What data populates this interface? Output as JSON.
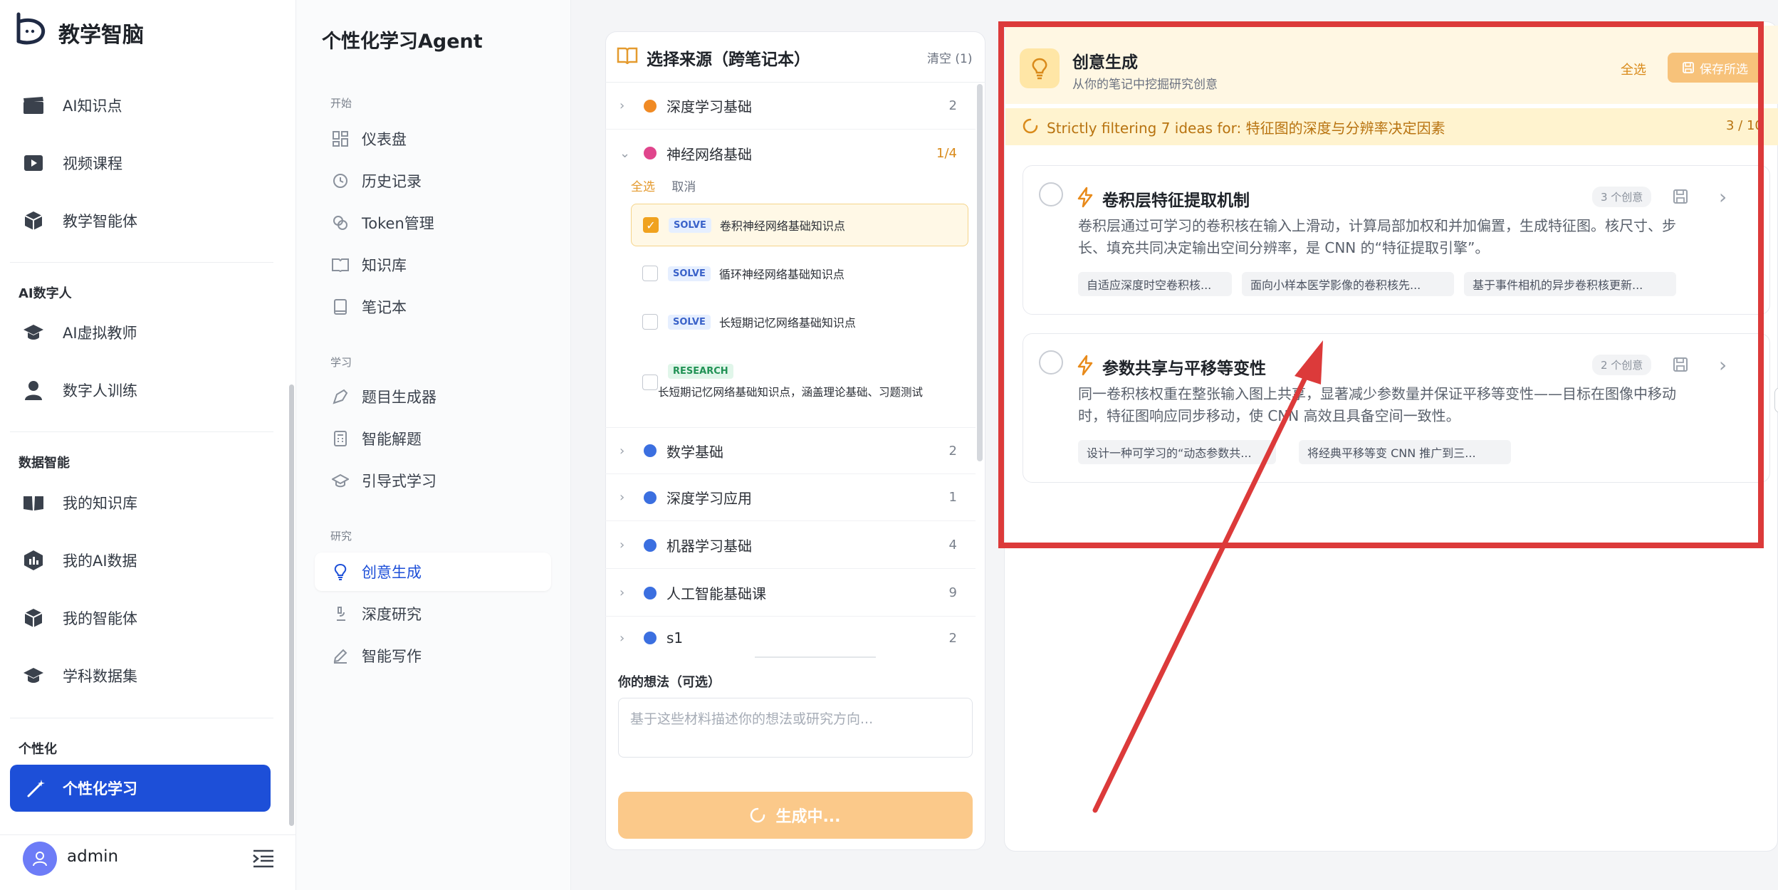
{
  "app": {
    "brand": "教学智脑"
  },
  "sidebar": {
    "items_top": [
      {
        "label": "AI知识点",
        "icon": "clapperboard-icon"
      },
      {
        "label": "视频课程",
        "icon": "video-play-icon"
      },
      {
        "label": "教学智能体",
        "icon": "cube-icon"
      }
    ],
    "section_digital": "AI数字人",
    "items_digital": [
      {
        "label": "AI虚拟教师",
        "icon": "graduation-cap-icon"
      },
      {
        "label": "数字人训练",
        "icon": "person-icon"
      }
    ],
    "section_data": "数据智能",
    "items_data": [
      {
        "label": "我的知识库",
        "icon": "open-book-icon"
      },
      {
        "label": "我的AI数据",
        "icon": "data-cube-icon"
      },
      {
        "label": "我的智能体",
        "icon": "cube-icon"
      },
      {
        "label": "学科数据集",
        "icon": "graduation-cap-icon"
      }
    ],
    "section_personal": "个性化",
    "active_item": "个性化学习",
    "user": "admin"
  },
  "subnav": {
    "title": "个性化学习Agent",
    "sec_start": "开始",
    "start_items": [
      "仪表盘",
      "历史记录",
      "Token管理",
      "知识库",
      "笔记本"
    ],
    "sec_learn": "学习",
    "learn_items": [
      "题目生成器",
      "智能解题",
      "引导式学习"
    ],
    "sec_research": "研究",
    "research_items": [
      "创意生成",
      "深度研究",
      "智能写作"
    ]
  },
  "sources": {
    "title": "选择来源（跨笔记本）",
    "clear": "清空 (1)",
    "select_all": "全选",
    "cancel": "取消",
    "notebooks": [
      {
        "name": "深度学习基础",
        "count": "2",
        "color": "#f08a24"
      },
      {
        "name": "神经网络基础",
        "count": "1/4",
        "color": "#e0458c"
      },
      {
        "name": "数学基础",
        "count": "2",
        "color": "#3b6fe0"
      },
      {
        "name": "深度学习应用",
        "count": "1",
        "color": "#3b6fe0"
      },
      {
        "name": "机器学习基础",
        "count": "4",
        "color": "#3b6fe0"
      },
      {
        "name": "人工智能基础课",
        "count": "9",
        "color": "#3b6fe0"
      },
      {
        "name": "s1",
        "count": "2",
        "color": "#3b6fe0"
      }
    ],
    "records": [
      {
        "tag": "SOLVE",
        "label": "卷积神经网络基础知识点",
        "checked": true
      },
      {
        "tag": "SOLVE",
        "label": "循环神经网络基础知识点",
        "checked": false
      },
      {
        "tag": "SOLVE",
        "label": "长短期记忆网络基础知识点",
        "checked": false
      },
      {
        "tag": "RESEARCH",
        "label": "长短期记忆网络基础知识点，涵盖理论基础、习题测试",
        "checked": false
      }
    ],
    "thought_label": "你的想法（可选）",
    "thought_placeholder": "基于这些材料描述你的想法或研究方向...",
    "generate_label": "生成中..."
  },
  "ideas": {
    "title": "创意生成",
    "subtitle": "从你的笔记中挖掘研究创意",
    "select_all": "全选",
    "save_selected": "保存所选",
    "status": "Strictly filtering 7 ideas for: 特征图的深度与分辨率决定因素",
    "progress": "3 / 10",
    "cards": [
      {
        "title": "卷积层特征提取机制",
        "count": "3 个创意",
        "desc_line1": "卷积层通过可学习的卷积核在输入上滑动，计算局部加权和并加偏置，生成特征图。核尺寸、步",
        "desc_line2": "长、填充共同决定输出空间分辨率，是 CNN 的“特征提取引擎”。",
        "chips": [
          "自适应深度时空卷积核...",
          "面向小样本医学影像的卷积核先...",
          "基于事件相机的异步卷积核更新..."
        ]
      },
      {
        "title": "参数共享与平移等变性",
        "count": "2 个创意",
        "desc_line1": "同一卷积核权重在整张输入图上共享，显著减少参数量并保证平移等变性——目标在图像中移动",
        "desc_line2": "时，特征图响应同步移动，使 CNN 高效且具备空间一致性。",
        "chips": [
          "设计一种可学习的“动态参数共...",
          "将经典平移等变 CNN 推广到三..."
        ]
      }
    ]
  },
  "colors": {
    "accent_blue": "#1d4fd8",
    "accent_orange": "#f0a21f",
    "annotation_red": "#dc3a3a"
  }
}
